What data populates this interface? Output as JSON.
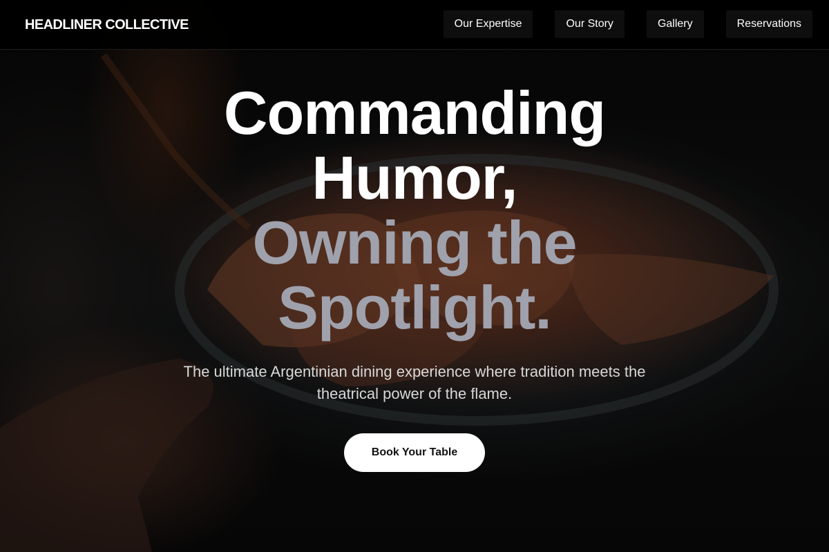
{
  "nav": {
    "brand": "HEADLINER COLLECTIVE",
    "links": [
      {
        "label": "Our Expertise"
      },
      {
        "label": "Our Story"
      },
      {
        "label": "Gallery"
      },
      {
        "label": "Reservations"
      }
    ]
  },
  "hero": {
    "headline_lines": [
      "Commanding",
      "Humor,",
      "Owning the",
      "Spotlight."
    ],
    "subtitle": "The ultimate Argentinian dining experience where tradition meets the theatrical power of the flame.",
    "cta_label": "Book Your Table",
    "background_image": "bowl-of-empanadas-photo"
  },
  "colors": {
    "nav_background": "#000000",
    "headline_primary": "#ffffff",
    "headline_accent": "#9fa1ac",
    "subtitle": "#d8d8d8",
    "cta_background": "#ffffff",
    "cta_text": "#111111"
  }
}
